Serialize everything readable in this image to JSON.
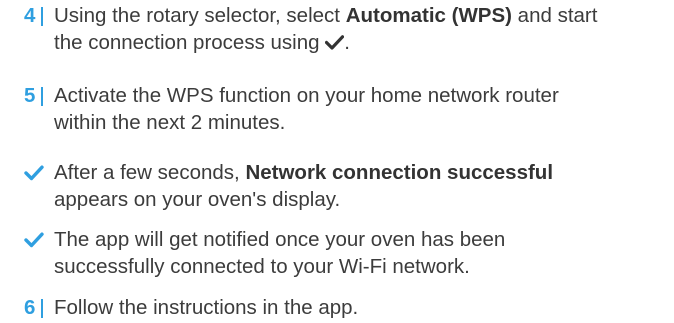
{
  "colors": {
    "accent": "#2f9fe0",
    "text": "#3c3c3c"
  },
  "steps": [
    {
      "number": "4",
      "line1_a": "Using the rotary selector, select ",
      "line1_bold": "Automatic (WPS)",
      "line1_b": " and start",
      "line2_a": "the connection process using ",
      "line2_icon": "checkmark-icon",
      "line2_b": "."
    },
    {
      "number": "5",
      "line1": "Activate the WPS function on your home network router",
      "line2": "within the next 2 minutes."
    },
    {
      "icon": "checkmark-icon",
      "line1_a": "After a few seconds, ",
      "line1_bold": "Network connection successful",
      "line2": "appears on your oven's display."
    },
    {
      "icon": "checkmark-icon",
      "line1": "The app will get notified once your oven has been",
      "line2": "successfully connected to your Wi-Fi network."
    },
    {
      "number": "6",
      "line1": "Follow the instructions in the app."
    }
  ]
}
